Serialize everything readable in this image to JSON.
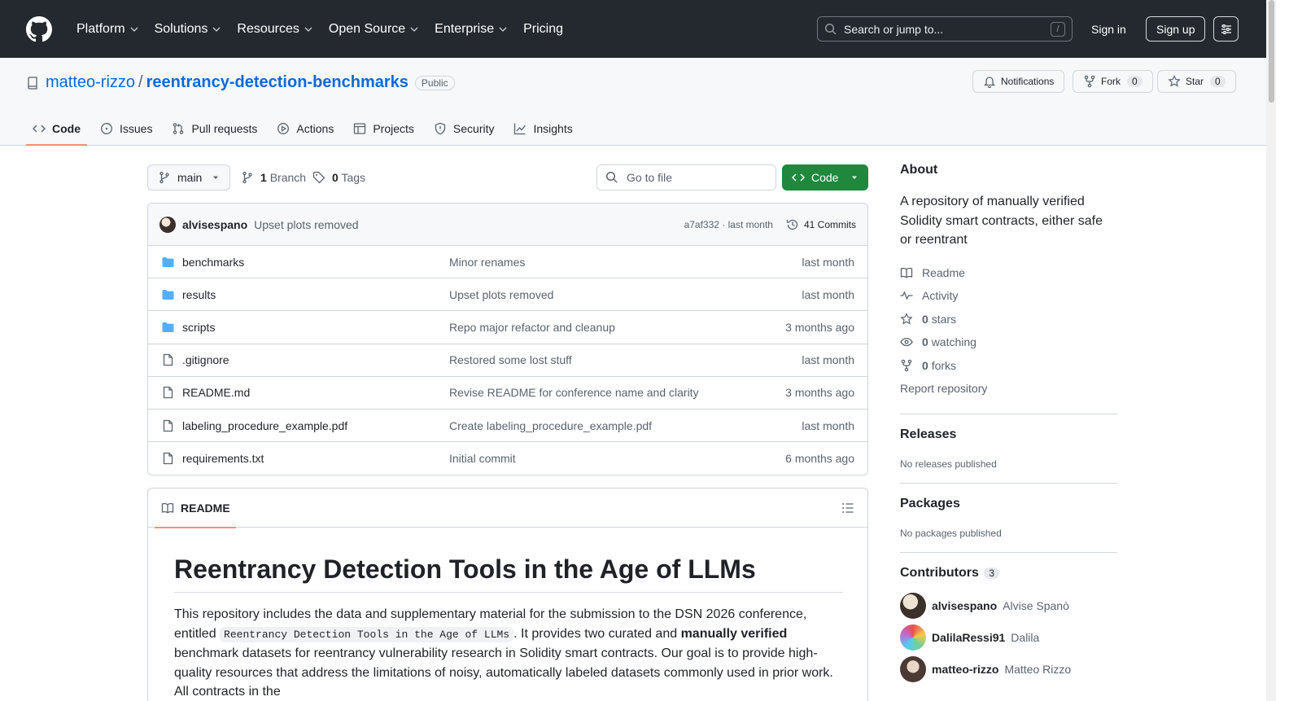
{
  "header": {
    "nav": [
      "Platform",
      "Solutions",
      "Resources",
      "Open Source",
      "Enterprise",
      "Pricing"
    ],
    "search_placeholder": "Search or jump to...",
    "search_key": "/",
    "signin": "Sign in",
    "signup": "Sign up"
  },
  "repo": {
    "owner": "matteo-rizzo",
    "separator": "/",
    "name": "reentrancy-detection-benchmarks",
    "visibility": "Public",
    "notifications": "Notifications",
    "fork_label": "Fork",
    "fork_count": "0",
    "star_label": "Star",
    "star_count": "0",
    "tabs": [
      "Code",
      "Issues",
      "Pull requests",
      "Actions",
      "Projects",
      "Security",
      "Insights"
    ]
  },
  "toolbar": {
    "branch": "main",
    "branches_count": "1",
    "branches_label": "Branch",
    "tags_count": "0",
    "tags_label": "Tags",
    "goto_file": "Go to file",
    "code_button": "Code"
  },
  "commit": {
    "author": "alvisespano",
    "message": "Upset plots removed",
    "meta": "a7af332 · last month",
    "commits": "41 Commits"
  },
  "files": [
    {
      "name": "benchmarks",
      "type": "folder",
      "message": "Minor renames",
      "time": "last month"
    },
    {
      "name": "results",
      "type": "folder",
      "message": "Upset plots removed",
      "time": "last month"
    },
    {
      "name": "scripts",
      "type": "folder",
      "message": "Repo major refactor and cleanup",
      "time": "3 months ago"
    },
    {
      "name": ".gitignore",
      "type": "file",
      "message": "Restored some lost stuff",
      "time": "last month"
    },
    {
      "name": "README.md",
      "type": "file",
      "message": "Revise README for conference name and clarity",
      "time": "3 months ago"
    },
    {
      "name": "labeling_procedure_example.pdf",
      "type": "file",
      "message": "Create labeling_procedure_example.pdf",
      "time": "last month"
    },
    {
      "name": "requirements.txt",
      "type": "file",
      "message": "Initial commit",
      "time": "6 months ago"
    }
  ],
  "readme": {
    "tab": "README",
    "title": "Reentrancy Detection Tools in the Age of LLMs",
    "p_part1": "This repository includes the data and supplementary material for the submission to the DSN 2026 conference, entitled",
    "p_code": "Reentrancy Detection Tools in the Age of LLMs",
    "p_part2": ". It provides two curated and",
    "p_bold": "manually verified",
    "p_part3": "benchmark datasets for reentrancy vulnerability research in Solidity smart contracts. Our goal is to provide high-quality resources that address the limitations of noisy, automatically labeled datasets commonly used in prior work. All contracts in the"
  },
  "sidebar": {
    "about_title": "About",
    "description": "A repository of manually verified Solidity smart contracts, either safe or reentrant",
    "links": [
      {
        "icon": "book-icon",
        "bold": "",
        "label": "Readme"
      },
      {
        "icon": "pulse-icon",
        "bold": "",
        "label": "Activity"
      },
      {
        "icon": "star-icon",
        "bold": "0",
        "label": "stars"
      },
      {
        "icon": "eye-icon",
        "bold": "0",
        "label": "watching"
      },
      {
        "icon": "fork-icon",
        "bold": "0",
        "label": "forks"
      }
    ],
    "report": "Report repository",
    "releases_title": "Releases",
    "releases_text": "No releases published",
    "packages_title": "Packages",
    "packages_text": "No packages published",
    "contributors_title": "Contributors",
    "contributors_count": "3",
    "contributors": [
      {
        "login": "alvisespano",
        "name": "Alvise Spanò"
      },
      {
        "login": "DalilaRessi91",
        "name": "Dalila"
      },
      {
        "login": "matteo-rizzo",
        "name": "Matteo Rizzo"
      }
    ]
  }
}
